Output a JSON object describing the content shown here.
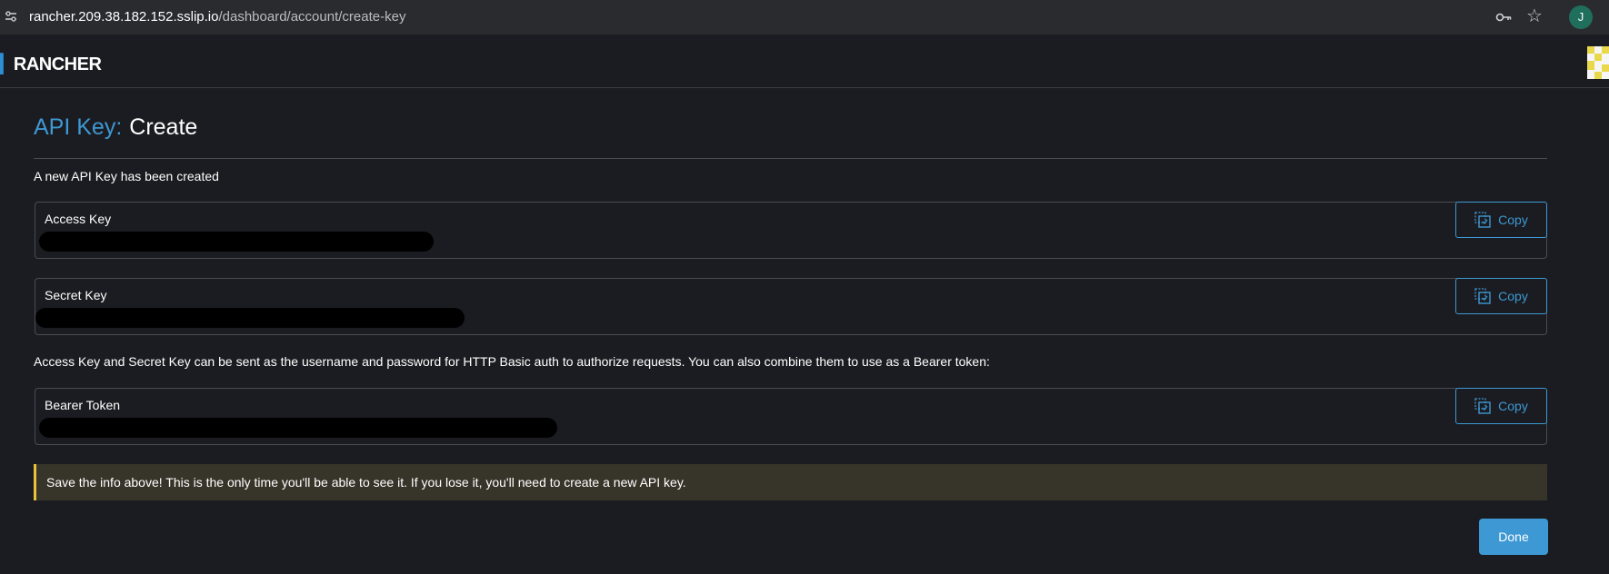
{
  "browser": {
    "url_domain": "rancher.209.38.182.152.sslip.io",
    "url_path": "/dashboard/account/create-key",
    "profile_initial": "J"
  },
  "header": {
    "logo_text": "RANCHER"
  },
  "page": {
    "title_prefix": "API Key:",
    "title_action": "Create",
    "created_message": "A new API Key has been created",
    "info_text": "Access Key and Secret Key can be sent as the username and password for HTTP Basic auth to authorize requests. You can also combine them to use as a Bearer token:",
    "warning_text": "Save the info above! This is the only time you'll be able to see it. If you lose it, you'll need to create a new API key.",
    "done_label": "Done"
  },
  "keys": [
    {
      "label": "Access Key",
      "copy_label": "Copy"
    },
    {
      "label": "Secret Key",
      "copy_label": "Copy"
    },
    {
      "label": "Bearer Token",
      "copy_label": "Copy"
    }
  ],
  "colors": {
    "accent": "#3d98d3",
    "background": "#1b1c21",
    "warning_border": "#e8c33a",
    "warning_bg": "#37352a"
  }
}
